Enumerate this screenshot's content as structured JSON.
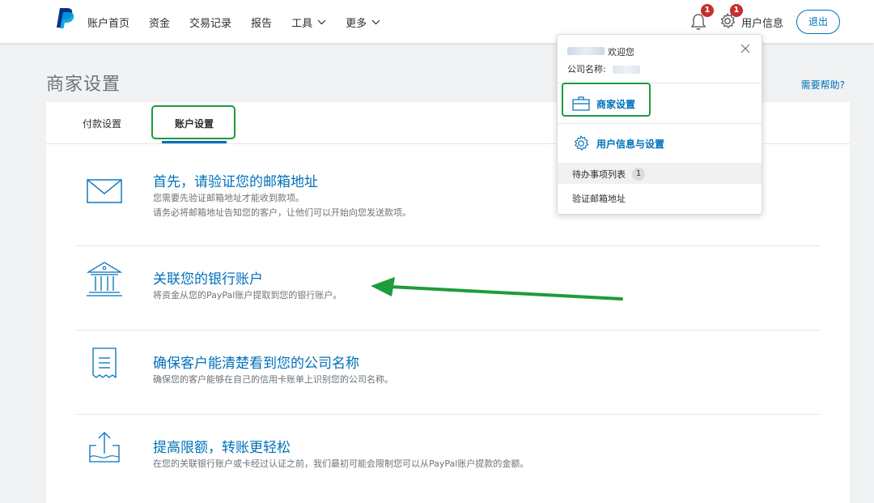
{
  "nav": {
    "links": [
      "账户首页",
      "资金",
      "交易记录",
      "报告",
      "工具",
      "更多"
    ],
    "notification_count": "1",
    "settings_count": "1",
    "user_label": "用户信息",
    "logout_label": "退出"
  },
  "page": {
    "title": "商家设置",
    "help": "需要帮助?"
  },
  "tabs": [
    "付款设置",
    "账户设置"
  ],
  "items": [
    {
      "title": "首先，请验证您的邮箱地址",
      "desc": [
        "您需要先验证邮箱地址才能收到款项。",
        "请务必将邮箱地址告知您的客户，让他们可以开始向您发送款项。"
      ],
      "icon": "envelope-icon"
    },
    {
      "title": "关联您的银行账户",
      "desc": [
        "将资金从您的PayPal账户提取到您的银行账户。"
      ],
      "icon": "bank-icon"
    },
    {
      "title": "确保客户能清楚看到您的公司名称",
      "desc": [
        "确保您的客户能够在自己的信用卡账单上识别您的公司名称。"
      ],
      "icon": "receipt-icon"
    },
    {
      "title": "提高限额，转账更轻松",
      "desc": [
        "在您的关联银行账户或卡经过认证之前，我们最初可能会限制您可以从PayPal账户提款的金额。"
      ],
      "icon": "upload-icon"
    }
  ],
  "dropdown": {
    "welcome": "欢迎您",
    "company_label": "公司名称:",
    "merchant_settings": "商家设置",
    "user_settings": "用户信息与设置",
    "todo_label": "待办事项列表",
    "todo_count": "1",
    "todo_item": "验证邮箱地址"
  },
  "colors": {
    "brand_blue": "#0070ba",
    "highlight_green": "#1e9c3b",
    "badge_red": "#c72e2e"
  }
}
